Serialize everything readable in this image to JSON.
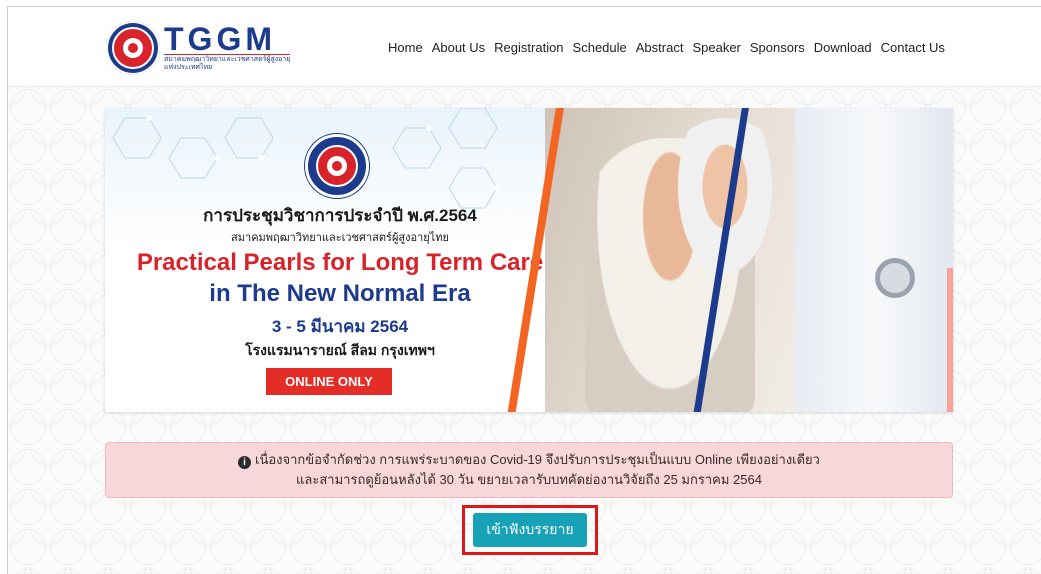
{
  "navbar": {
    "logo": {
      "brand": "TGGM",
      "subtitle_line1": "สมาคมพฤฒาวิทยาและเวชศาสตร์ผู้สูงอายุ",
      "subtitle_line2": "แห่งประเทศไทย"
    },
    "menu": [
      "Home",
      "About Us",
      "Registration",
      "Schedule",
      "Abstract",
      "Speaker",
      "Sponsors",
      "Download",
      "Contact Us"
    ]
  },
  "banner": {
    "title_th": "การประชุมวิชาการประจำปี พ.ศ.2564",
    "org_th": "สมาคมพฤฒาวิทยาและเวชศาสตร์ผู้สูงอายุไทย",
    "headline_line1": "Practical Pearls for Long Term Care",
    "headline_line2": "in The New Normal Era",
    "date": "3 - 5 มีนาคม 2564",
    "venue": "โรงแรมนารายณ์ สีลม กรุงเทพฯ",
    "badge": "ONLINE ONLY"
  },
  "alert": {
    "line1": "เนื่องจากข้อจำกัดช่วง การแพร่ระบาดของ Covid-19 จึงปรับการประชุมเป็นแบบ Online เพียงอย่างเดียว",
    "line2": "และสามารถดูย้อนหลังได้ 30 วัน ขยายเวลารับบทคัดย่องานวิจัยถึง 25 มกราคม 2564",
    "icon": "info-circle-icon"
  },
  "cta": {
    "label": "เข้าฟังบรรยาย"
  },
  "colors": {
    "brand_blue": "#1d3b8c",
    "brand_red": "#d8232a",
    "cta": "#17a2b8",
    "alert_bg": "#f8d7da",
    "highlight": "#e0161b"
  }
}
